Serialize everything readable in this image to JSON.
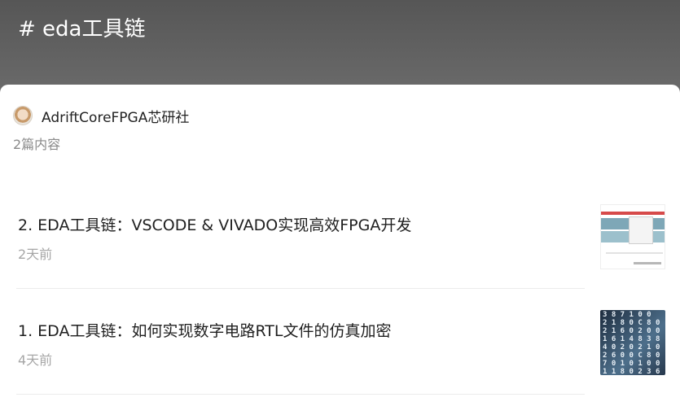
{
  "header": {
    "title": "# eda工具链"
  },
  "author": {
    "name": "AdriftCoreFPGA芯研社"
  },
  "post_count": "2篇内容",
  "articles": [
    {
      "title": "2. EDA工具链：VSCODE & VIVADO实现高效FPGA开发",
      "time": "2天前",
      "thumbnail": "vivado-screenshot-thumbnail"
    },
    {
      "title": "1. EDA工具链：如何实现数字电路RTL文件的仿真加密",
      "time": "4天前",
      "thumbnail": "binary-code-thumbnail"
    }
  ],
  "colors": {
    "header_bg": "#5f5f5f",
    "title_text": "#1f1f1f",
    "muted_text": "#a6a6a6"
  }
}
